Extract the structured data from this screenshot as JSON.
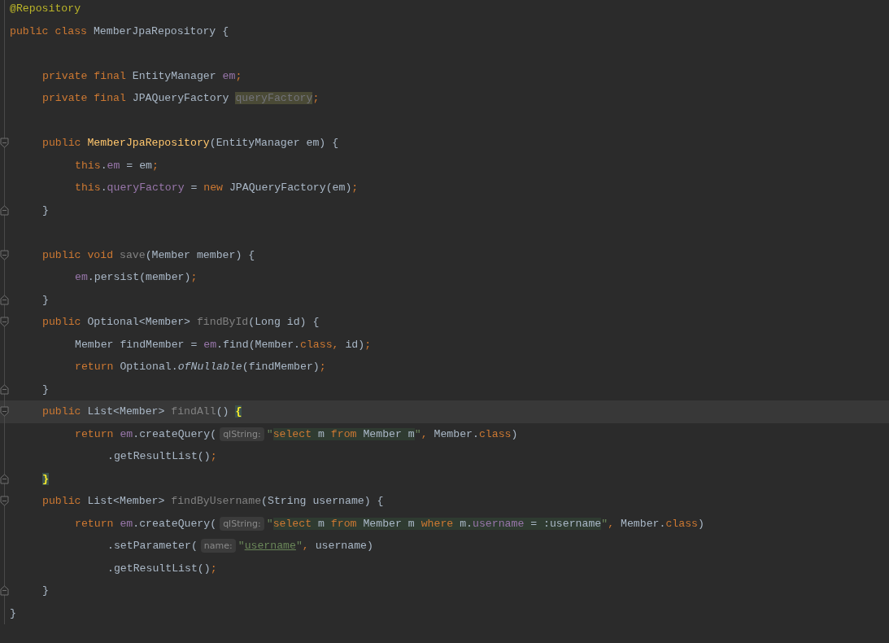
{
  "editor": {
    "lines": [
      {
        "kind": "top",
        "tokens": [
          {
            "kind": "annotation",
            "text": "@Repository"
          }
        ]
      },
      {
        "kind": "top",
        "tokens": [
          {
            "kind": "keyword",
            "text": "public class "
          },
          {
            "kind": "plain",
            "text": "MemberJpaRepository {"
          }
        ]
      },
      {
        "kind": "blank"
      },
      {
        "kind": "member",
        "tokens": [
          {
            "kind": "keyword",
            "text": "private final "
          },
          {
            "kind": "plain",
            "text": "EntityManager "
          },
          {
            "kind": "field",
            "text": "em"
          },
          {
            "kind": "punct",
            "text": ";"
          }
        ]
      },
      {
        "kind": "member",
        "tokens": [
          {
            "kind": "keyword",
            "text": "private final "
          },
          {
            "kind": "plain",
            "text": "JPAQueryFactory "
          },
          {
            "kind": "unused-field",
            "text": "queryFactory"
          },
          {
            "kind": "punct",
            "text": ";"
          }
        ]
      },
      {
        "kind": "blank"
      },
      {
        "kind": "member",
        "fold_open": true,
        "tokens": [
          {
            "kind": "keyword",
            "text": "public "
          },
          {
            "kind": "declaration",
            "text": "MemberJpaRepository"
          },
          {
            "kind": "plain",
            "text": "(EntityManager em) {"
          }
        ]
      },
      {
        "kind": "statement",
        "tokens": [
          {
            "kind": "keyword",
            "text": "this"
          },
          {
            "kind": "plain",
            "text": "."
          },
          {
            "kind": "field",
            "text": "em"
          },
          {
            "kind": "plain",
            "text": " = em"
          },
          {
            "kind": "punct",
            "text": ";"
          }
        ]
      },
      {
        "kind": "statement",
        "tokens": [
          {
            "kind": "keyword",
            "text": "this"
          },
          {
            "kind": "plain",
            "text": "."
          },
          {
            "kind": "field",
            "text": "queryFactory"
          },
          {
            "kind": "plain",
            "text": " = "
          },
          {
            "kind": "keyword",
            "text": "new "
          },
          {
            "kind": "plain",
            "text": "JPAQueryFactory(em)"
          },
          {
            "kind": "punct",
            "text": ";"
          }
        ]
      },
      {
        "kind": "member",
        "fold_close": true,
        "tokens": [
          {
            "kind": "plain",
            "text": "}"
          }
        ]
      },
      {
        "kind": "blank"
      },
      {
        "kind": "member",
        "fold_open": true,
        "tokens": [
          {
            "kind": "keyword",
            "text": "public void "
          },
          {
            "kind": "unused",
            "text": "save"
          },
          {
            "kind": "plain",
            "text": "(Member member) {"
          }
        ]
      },
      {
        "kind": "statement",
        "tokens": [
          {
            "kind": "field",
            "text": "em"
          },
          {
            "kind": "plain",
            "text": ".persist(member)"
          },
          {
            "kind": "punct",
            "text": ";"
          }
        ]
      },
      {
        "kind": "member",
        "fold_close": true,
        "tokens": [
          {
            "kind": "plain",
            "text": "}"
          }
        ]
      },
      {
        "kind": "member",
        "fold_open": true,
        "tokens": [
          {
            "kind": "keyword",
            "text": "public "
          },
          {
            "kind": "plain",
            "text": "Optional<Member> "
          },
          {
            "kind": "unused",
            "text": "findById"
          },
          {
            "kind": "plain",
            "text": "(Long id) {"
          }
        ]
      },
      {
        "kind": "statement",
        "tokens": [
          {
            "kind": "plain",
            "text": "Member findMember = "
          },
          {
            "kind": "field",
            "text": "em"
          },
          {
            "kind": "plain",
            "text": ".find(Member."
          },
          {
            "kind": "keyword",
            "text": "class"
          },
          {
            "kind": "punct",
            "text": ", "
          },
          {
            "kind": "plain",
            "text": "id)"
          },
          {
            "kind": "punct",
            "text": ";"
          }
        ]
      },
      {
        "kind": "statement",
        "tokens": [
          {
            "kind": "keyword",
            "text": "return "
          },
          {
            "kind": "plain",
            "text": "Optional."
          },
          {
            "kind": "static",
            "text": "ofNullable"
          },
          {
            "kind": "plain",
            "text": "(findMember)"
          },
          {
            "kind": "punct",
            "text": ";"
          }
        ]
      },
      {
        "kind": "member",
        "fold_close": true,
        "tokens": [
          {
            "kind": "plain",
            "text": "}"
          }
        ]
      },
      {
        "kind": "member",
        "fold_open": true,
        "current": true,
        "tokens": [
          {
            "kind": "keyword",
            "text": "public "
          },
          {
            "kind": "plain",
            "text": "List<Member> "
          },
          {
            "kind": "unused",
            "text": "findAll"
          },
          {
            "kind": "plain",
            "text": "() "
          },
          {
            "kind": "brace-match",
            "text": "{"
          }
        ]
      },
      {
        "kind": "statement",
        "tokens": [
          {
            "kind": "keyword",
            "text": "return "
          },
          {
            "kind": "field",
            "text": "em"
          },
          {
            "kind": "plain",
            "text": ".createQuery("
          },
          {
            "kind": "hint",
            "text": "qlString:"
          },
          {
            "kind": "string",
            "text": "\""
          },
          {
            "kind": "sql-keyword",
            "text": "select "
          },
          {
            "kind": "sql",
            "text": "m "
          },
          {
            "kind": "sql-keyword",
            "text": "from "
          },
          {
            "kind": "sql",
            "text": "Member m"
          },
          {
            "kind": "string",
            "text": "\""
          },
          {
            "kind": "punct",
            "text": ", "
          },
          {
            "kind": "plain",
            "text": "Member."
          },
          {
            "kind": "keyword",
            "text": "class"
          },
          {
            "kind": "plain",
            "text": ")"
          }
        ]
      },
      {
        "kind": "continuation",
        "tokens": [
          {
            "kind": "plain",
            "text": ".getResultList()"
          },
          {
            "kind": "punct",
            "text": ";"
          }
        ]
      },
      {
        "kind": "member",
        "fold_close": true,
        "tokens": [
          {
            "kind": "brace-match",
            "text": "}"
          }
        ]
      },
      {
        "kind": "member",
        "fold_open": true,
        "tokens": [
          {
            "kind": "keyword",
            "text": "public "
          },
          {
            "kind": "plain",
            "text": "List<Member> "
          },
          {
            "kind": "unused",
            "text": "findByUsername"
          },
          {
            "kind": "plain",
            "text": "(String username) {"
          }
        ]
      },
      {
        "kind": "statement",
        "tokens": [
          {
            "kind": "keyword",
            "text": "return "
          },
          {
            "kind": "field",
            "text": "em"
          },
          {
            "kind": "plain",
            "text": ".createQuery("
          },
          {
            "kind": "hint",
            "text": "qlString:"
          },
          {
            "kind": "string",
            "text": "\""
          },
          {
            "kind": "sql-keyword",
            "text": "select "
          },
          {
            "kind": "sql",
            "text": "m "
          },
          {
            "kind": "sql-keyword",
            "text": "from "
          },
          {
            "kind": "sql",
            "text": "Member m "
          },
          {
            "kind": "sql-keyword",
            "text": "where "
          },
          {
            "kind": "sql",
            "text": "m."
          },
          {
            "kind": "sql-field",
            "text": "username"
          },
          {
            "kind": "sql",
            "text": " = :username"
          },
          {
            "kind": "string",
            "text": "\""
          },
          {
            "kind": "punct",
            "text": ", "
          },
          {
            "kind": "plain",
            "text": "Member."
          },
          {
            "kind": "keyword",
            "text": "class"
          },
          {
            "kind": "plain",
            "text": ")"
          }
        ]
      },
      {
        "kind": "continuation",
        "tokens": [
          {
            "kind": "plain",
            "text": ".setParameter("
          },
          {
            "kind": "hint",
            "text": "name:"
          },
          {
            "kind": "string",
            "text": "\""
          },
          {
            "kind": "reference",
            "text": "username"
          },
          {
            "kind": "string",
            "text": "\""
          },
          {
            "kind": "punct",
            "text": ", "
          },
          {
            "kind": "plain",
            "text": "username)"
          }
        ]
      },
      {
        "kind": "continuation",
        "tokens": [
          {
            "kind": "plain",
            "text": ".getResultList()"
          },
          {
            "kind": "punct",
            "text": ";"
          }
        ]
      },
      {
        "kind": "member",
        "fold_close": true,
        "tokens": [
          {
            "kind": "plain",
            "text": "}"
          }
        ]
      },
      {
        "kind": "top",
        "tokens": [
          {
            "kind": "plain",
            "text": "}"
          }
        ]
      }
    ]
  }
}
